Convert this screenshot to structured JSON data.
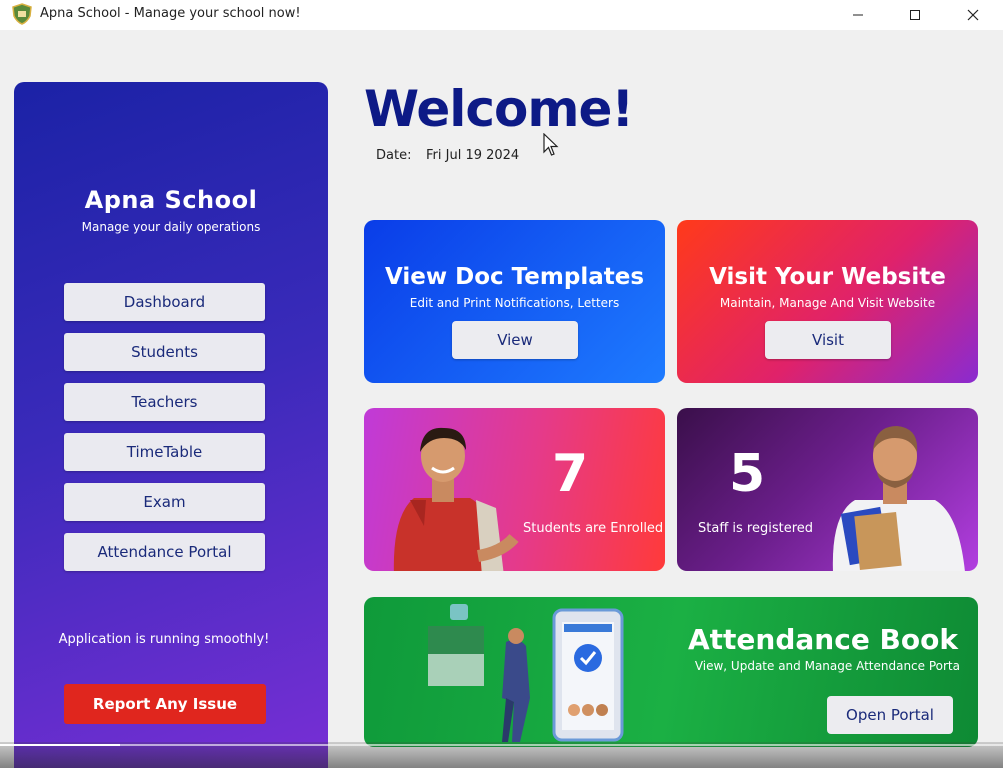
{
  "window": {
    "title": "Apna School - Manage your school now!",
    "minimize": "—",
    "maximize": "☐",
    "close": "✕"
  },
  "sidebar": {
    "title": "Apna School",
    "subtitle": "Manage your daily operations",
    "items": [
      {
        "label": "Dashboard"
      },
      {
        "label": "Students"
      },
      {
        "label": "Teachers"
      },
      {
        "label": "TimeTable"
      },
      {
        "label": "Exam"
      },
      {
        "label": "Attendance Portal"
      }
    ],
    "status": "Application is running smoothly!",
    "report_label": "Report Any Issue"
  },
  "header": {
    "welcome": "Welcome!",
    "date_label": "Date:",
    "date_value": "Fri Jul 19 2024"
  },
  "cards": {
    "doc": {
      "title": "View Doc Templates",
      "subtitle": "Edit and Print Notifications, Letters",
      "button": "View"
    },
    "website": {
      "title": "Visit Your Website",
      "subtitle": "Maintain, Manage And Visit Website",
      "button": "Visit"
    },
    "students": {
      "count": "7",
      "label": "Students are Enrolled"
    },
    "staff": {
      "count": "5",
      "label": "Staff is registered"
    },
    "attendance": {
      "title": "Attendance Book",
      "subtitle": "View, Update and Manage Attendance Porta",
      "button": "Open Portal"
    }
  },
  "colors": {
    "sidebar_top": "#1b22a6",
    "sidebar_bottom": "#7a2fd6",
    "welcome": "#0d1a86",
    "report": "#e0261e",
    "doc_card": "#0a3de8",
    "website_card": "#e0226a",
    "students_card": "#e53a8a",
    "staff_card": "#6a1e8a",
    "attendance_card": "#1bb044"
  },
  "icons": {
    "app": "school-crest-icon",
    "cursor": "mouse-cursor-icon"
  },
  "video": {
    "progress": 0.12
  }
}
